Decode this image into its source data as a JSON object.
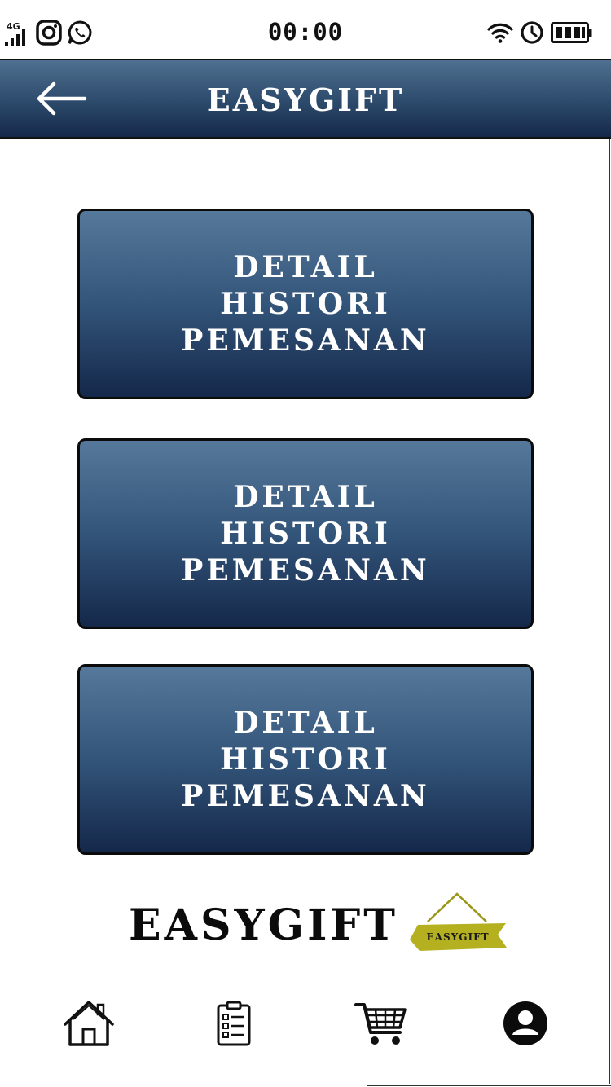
{
  "status_bar": {
    "network": "4G",
    "time": "00:00"
  },
  "header": {
    "title": "EASYGIFT"
  },
  "history_cards": [
    {
      "label": "DETAIL\nHISTORI\nPEMESANAN"
    },
    {
      "label": "DETAIL\nHISTORI\nPEMESANAN"
    },
    {
      "label": "DETAIL\nHISTORI\nPEMESANAN"
    }
  ],
  "brand": {
    "name": "EASYGIFT",
    "logo_text": "EASYGIFT",
    "logo_color": "#b5b020"
  },
  "colors": {
    "header_top": "#4f7090",
    "header_bottom": "#14284a",
    "text_light": "#ffffff",
    "text_dark": "#0b0b0b"
  },
  "bottom_nav": {
    "items": [
      {
        "icon": "home-icon"
      },
      {
        "icon": "clipboard-list-icon"
      },
      {
        "icon": "shopping-cart-icon"
      },
      {
        "icon": "user-profile-icon"
      }
    ]
  }
}
